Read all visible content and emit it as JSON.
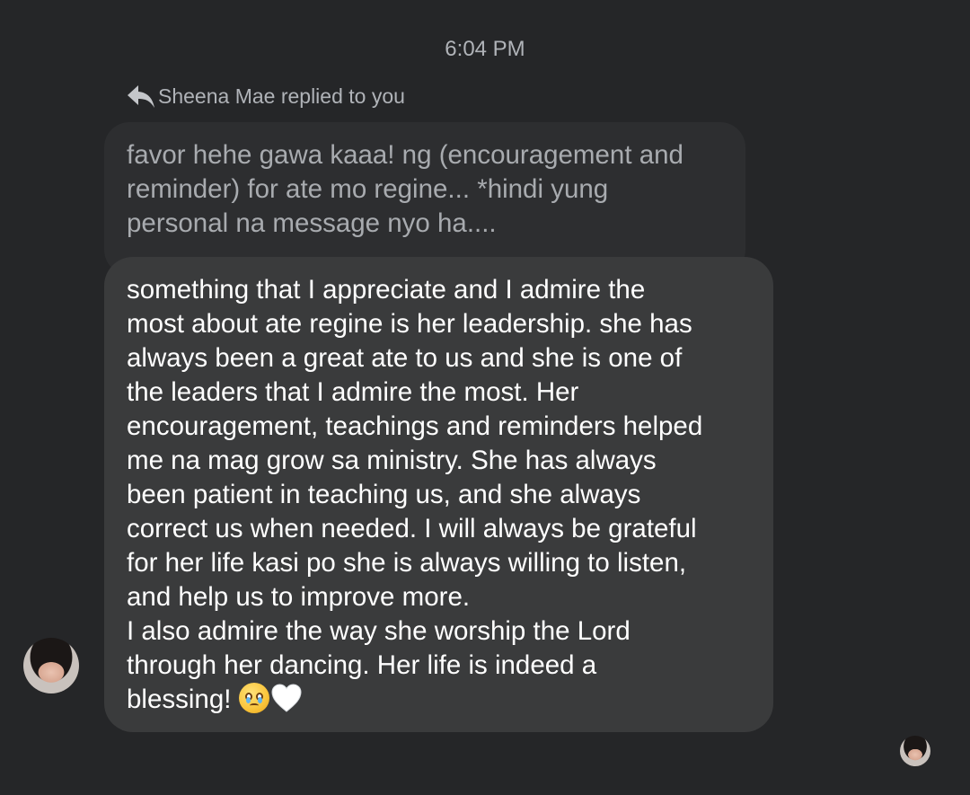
{
  "timestamp": "6:04 PM",
  "reply": {
    "icon": "reply-arrow-icon",
    "label": "Sheena Mae replied to you"
  },
  "quoted_message": {
    "text": "favor hehe gawa kaaa! ng (encouragement and\nreminder) for ate mo regine... *hindi yung\npersonal na message nyo ha...."
  },
  "message": {
    "text": "something that I appreciate and I admire the\nmost about ate regine is her leadership. she has\nalways been a great ate to us and she is one of\nthe leaders that I admire the most.  Her\nencouragement, teachings and reminders helped\nme na mag grow sa ministry. She has always\nbeen patient in teaching us, and she always\ncorrect us when needed. I will always be grateful\nfor her life kasi po she is always willing to listen,\nand help us to improve more.\nI also admire the way she worship the Lord\nthrough her dancing. Her life is indeed a\nblessing! ",
    "emojis": [
      "face-holding-back-tears-emoji",
      "white-heart-emoji"
    ]
  },
  "sender": {
    "avatar": "sender-avatar"
  },
  "read_receipt": {
    "avatar": "read-receipt-avatar"
  },
  "colors": {
    "background": "#252628",
    "quoted_bubble": "#2d2e30",
    "message_bubble": "#3a3b3c",
    "secondary_text": "#b0b3b8",
    "primary_text": "#ffffff"
  }
}
